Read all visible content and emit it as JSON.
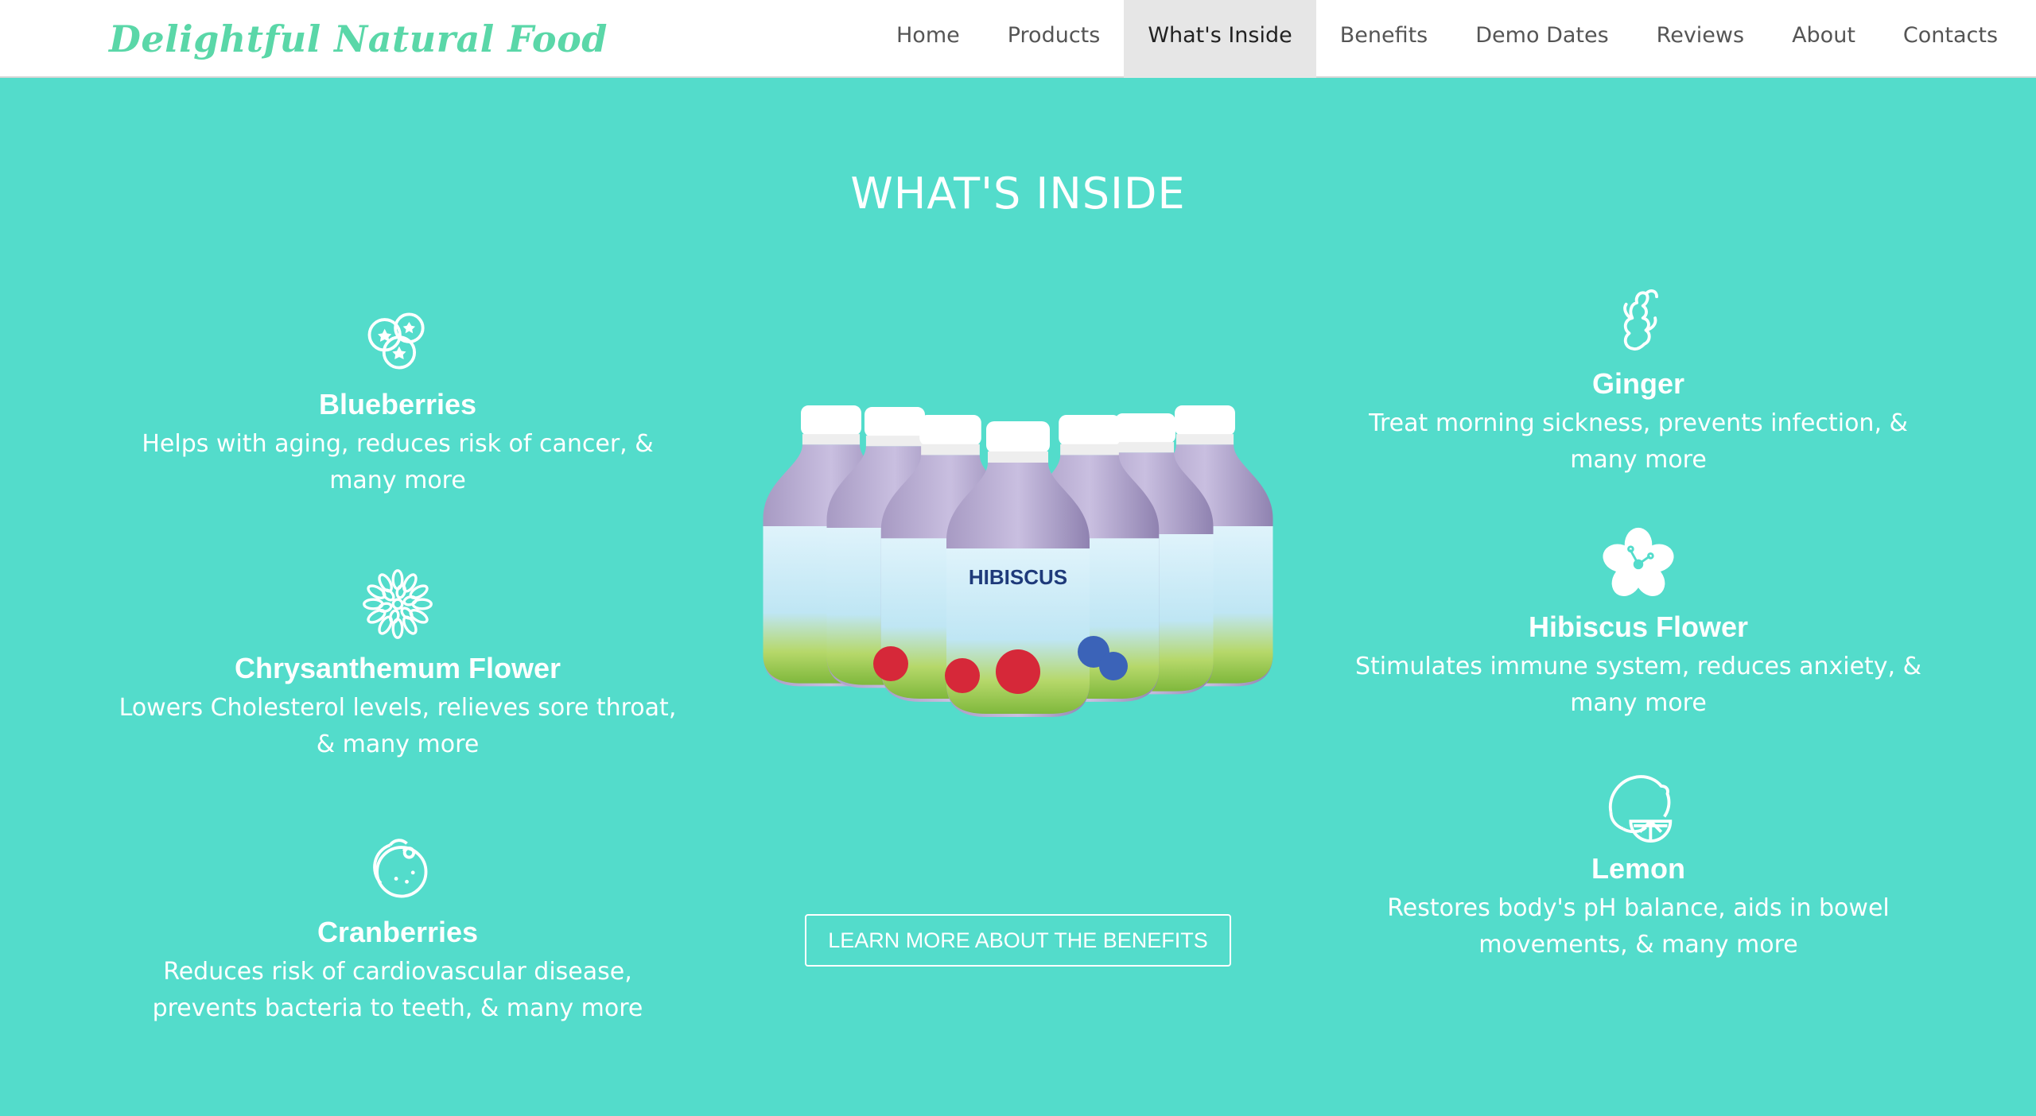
{
  "brand": {
    "logo_text": "Delightful Natural Food"
  },
  "nav": {
    "items": [
      {
        "label": "Home"
      },
      {
        "label": "Products"
      },
      {
        "label": "What's Inside",
        "active": true
      },
      {
        "label": "Benefits"
      },
      {
        "label": "Demo Dates"
      },
      {
        "label": "Reviews"
      },
      {
        "label": "About"
      },
      {
        "label": "Contacts"
      }
    ]
  },
  "section": {
    "title": "WHAT'S INSIDE"
  },
  "ingredients_left": [
    {
      "icon": "blueberries-icon",
      "name": "Blueberries",
      "desc": "Helps with aging, reduces risk of cancer, & many more"
    },
    {
      "icon": "chrysanthemum-flower-icon",
      "name": "Chrysanthemum Flower",
      "desc": "Lowers Cholesterol levels, relieves sore throat, & many more"
    },
    {
      "icon": "cranberries-icon",
      "name": "Cranberries",
      "desc": "Reduces risk of cardiovascular disease, prevents bacteria to teeth, & many more"
    }
  ],
  "ingredients_right": [
    {
      "icon": "ginger-icon",
      "name": "Ginger",
      "desc": "Treat morning sickness, prevents infection, & many more"
    },
    {
      "icon": "hibiscus-flower-icon",
      "name": "Hibiscus Flower",
      "desc": "Stimulates immune system, reduces anxiety, & many more"
    },
    {
      "icon": "lemon-icon",
      "name": "Lemon",
      "desc": "Restores body's pH balance, aids in bowel movements, & many more"
    }
  ],
  "cta": {
    "label": "LEARN MORE ABOUT THE BENEFITS"
  },
  "colors": {
    "background": "#53dccb",
    "logo": "#5ad7a8",
    "nav_active_bg": "#e6e6e6",
    "text": "#ffffff"
  }
}
